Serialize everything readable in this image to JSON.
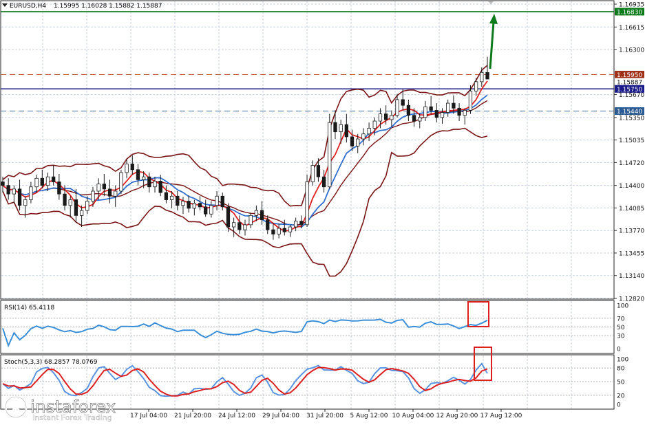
{
  "header": {
    "symbol_tf": "EURUSD,H4",
    "ohlc": "1.15995 1.16028 1.15882 1.15887"
  },
  "colors": {
    "bg": "#ffffff",
    "grid": "#c8d2de",
    "candle_bull": "#1a1a1a",
    "candle_bear": "#1a1a1a",
    "bollinger": "#7a1414",
    "ma_fast": "#e02020",
    "ma_slow": "#2f6fd0",
    "rsi_line": "#3a8fd8",
    "stoch_main": "#5b94e0",
    "stoch_signal": "#dd1f1f",
    "resistance": "#0b7a1b",
    "support": "#1a1a88",
    "level_dashed_upper": "#c0502a",
    "level_dashed_lower": "#3f6fa5",
    "highlight_box": "#dd1f1f",
    "arrow": "#0b7a1b"
  },
  "price_axis": {
    "ticks": [
      "1.16935",
      "1.16615",
      "1.16300",
      "1.15670",
      "1.15350",
      "1.15035",
      "1.14720",
      "1.14400",
      "1.14085",
      "1.13770",
      "1.13455",
      "1.13140",
      "1.12820"
    ],
    "tick_values": [
      1.16935,
      1.16615,
      1.163,
      1.1567,
      1.1535,
      1.15035,
      1.1472,
      1.144,
      1.14085,
      1.1377,
      1.13455,
      1.1314,
      1.1282
    ]
  },
  "levels": {
    "resistance": {
      "label": "1.16830",
      "value": 1.1683
    },
    "dashed_upper": {
      "label": "1.15950",
      "value": 1.1595
    },
    "current": {
      "label": "1.15887",
      "value": 1.15887
    },
    "support": {
      "label": "1.15750",
      "value": 1.1575
    },
    "dashed_lower": {
      "label": "1.15440",
      "value": 1.1544
    }
  },
  "rsi": {
    "label": "RSI(14) 65.4118",
    "ticks": [
      "100",
      "70",
      "50",
      "30",
      "0"
    ],
    "tick_values": [
      100,
      70,
      50,
      30,
      0
    ]
  },
  "stoch": {
    "label": "Stoch(5,3,3) 68.2857 78.0769",
    "ticks": [
      "100",
      "80",
      "50",
      "20",
      "0"
    ],
    "tick_values": [
      100,
      80,
      50,
      20,
      0
    ]
  },
  "time_axis": {
    "labels": [
      "17 Jul 04:00",
      "21 Jul 20:00",
      "24 Jul 12:00",
      "29 Jul 04:00",
      "31 Jul 20:00",
      "5 Aug 12:00",
      "10 Aug 04:00",
      "12 Aug 20:00",
      "17 Aug 12:00"
    ]
  },
  "watermark": {
    "brand": "instaforex",
    "tagline": "Instant Forex Trading"
  },
  "chart_data": {
    "type": "candlestick",
    "symbol": "EURUSD",
    "timeframe": "H4",
    "ylim": [
      1.1282,
      1.16935
    ],
    "indicators": [
      "Bollinger Bands",
      "Moving Average (fast)",
      "Moving Average (slow)",
      "RSI(14)",
      "Stoch(5,3,3)"
    ],
    "ohlc": [
      [
        1.1445,
        1.1452,
        1.143,
        1.144
      ],
      [
        1.144,
        1.145,
        1.142,
        1.1428
      ],
      [
        1.1428,
        1.144,
        1.1415,
        1.1435
      ],
      [
        1.1435,
        1.1448,
        1.1405,
        1.1412
      ],
      [
        1.1412,
        1.1425,
        1.1395,
        1.142
      ],
      [
        1.142,
        1.1445,
        1.1415,
        1.1438
      ],
      [
        1.1438,
        1.1455,
        1.143,
        1.145
      ],
      [
        1.145,
        1.1462,
        1.1436,
        1.144
      ],
      [
        1.144,
        1.1458,
        1.1432,
        1.1452
      ],
      [
        1.1452,
        1.1468,
        1.144,
        1.1445
      ],
      [
        1.1445,
        1.1456,
        1.142,
        1.1428
      ],
      [
        1.1428,
        1.144,
        1.1405,
        1.1412
      ],
      [
        1.1412,
        1.1425,
        1.1395,
        1.142
      ],
      [
        1.142,
        1.1435,
        1.1388,
        1.1398
      ],
      [
        1.1398,
        1.1412,
        1.1382,
        1.1405
      ],
      [
        1.1405,
        1.1425,
        1.14,
        1.1418
      ],
      [
        1.1418,
        1.1438,
        1.141,
        1.1432
      ],
      [
        1.1432,
        1.145,
        1.142,
        1.1442
      ],
      [
        1.1442,
        1.1456,
        1.1425,
        1.1435
      ],
      [
        1.1435,
        1.1448,
        1.1415,
        1.1425
      ],
      [
        1.1425,
        1.144,
        1.141,
        1.1432
      ],
      [
        1.1432,
        1.1462,
        1.1428,
        1.1458
      ],
      [
        1.1458,
        1.1476,
        1.145,
        1.147
      ],
      [
        1.147,
        1.1482,
        1.1455,
        1.1462
      ],
      [
        1.1462,
        1.147,
        1.144,
        1.1448
      ],
      [
        1.1448,
        1.146,
        1.1436,
        1.1452
      ],
      [
        1.1452,
        1.1458,
        1.143,
        1.1438
      ],
      [
        1.1438,
        1.1452,
        1.143,
        1.1446
      ],
      [
        1.1446,
        1.1455,
        1.1425,
        1.143
      ],
      [
        1.143,
        1.144,
        1.1415,
        1.142
      ],
      [
        1.142,
        1.1432,
        1.1408,
        1.1425
      ],
      [
        1.1425,
        1.1432,
        1.1405,
        1.1412
      ],
      [
        1.1412,
        1.1424,
        1.14,
        1.1418
      ],
      [
        1.1418,
        1.1426,
        1.1402,
        1.1408
      ],
      [
        1.1408,
        1.142,
        1.1398,
        1.1415
      ],
      [
        1.1415,
        1.1425,
        1.1405,
        1.141
      ],
      [
        1.141,
        1.142,
        1.1396,
        1.14
      ],
      [
        1.14,
        1.1418,
        1.1395,
        1.1412
      ],
      [
        1.1412,
        1.1432,
        1.1405,
        1.1425
      ],
      [
        1.1425,
        1.143,
        1.1405,
        1.141
      ],
      [
        1.141,
        1.1415,
        1.1375,
        1.1382
      ],
      [
        1.1382,
        1.1395,
        1.1368,
        1.1388
      ],
      [
        1.1388,
        1.1398,
        1.1372,
        1.1378
      ],
      [
        1.1378,
        1.1392,
        1.137,
        1.1385
      ],
      [
        1.1385,
        1.1402,
        1.138,
        1.1398
      ],
      [
        1.1398,
        1.1412,
        1.139,
        1.1405
      ],
      [
        1.1405,
        1.1418,
        1.1385,
        1.1392
      ],
      [
        1.1392,
        1.1398,
        1.1372,
        1.1378
      ],
      [
        1.1378,
        1.1388,
        1.1364,
        1.1372
      ],
      [
        1.1372,
        1.1386,
        1.1366,
        1.138
      ],
      [
        1.138,
        1.1392,
        1.137,
        1.1375
      ],
      [
        1.1375,
        1.1385,
        1.1368,
        1.1382
      ],
      [
        1.1382,
        1.1395,
        1.1376,
        1.139
      ],
      [
        1.139,
        1.1398,
        1.138,
        1.1385
      ],
      [
        1.1385,
        1.1455,
        1.1382,
        1.1445
      ],
      [
        1.1445,
        1.1475,
        1.144,
        1.1468
      ],
      [
        1.1468,
        1.1478,
        1.1445,
        1.1452
      ],
      [
        1.1452,
        1.1462,
        1.143,
        1.1438
      ],
      [
        1.1438,
        1.154,
        1.1435,
        1.1528
      ],
      [
        1.1528,
        1.1545,
        1.1505,
        1.1515
      ],
      [
        1.1515,
        1.1532,
        1.1498,
        1.1525
      ],
      [
        1.1525,
        1.154,
        1.15,
        1.1508
      ],
      [
        1.1508,
        1.1518,
        1.1488,
        1.1495
      ],
      [
        1.1495,
        1.1512,
        1.1485,
        1.1505
      ],
      [
        1.1505,
        1.152,
        1.1496,
        1.1512
      ],
      [
        1.1512,
        1.1528,
        1.1502,
        1.152
      ],
      [
        1.152,
        1.1535,
        1.151,
        1.153
      ],
      [
        1.153,
        1.1548,
        1.152,
        1.154
      ],
      [
        1.154,
        1.1552,
        1.1525,
        1.1532
      ],
      [
        1.1532,
        1.1545,
        1.1522,
        1.1538
      ],
      [
        1.1538,
        1.1568,
        1.1535,
        1.156
      ],
      [
        1.156,
        1.1575,
        1.1545,
        1.1552
      ],
      [
        1.1552,
        1.156,
        1.153,
        1.1538
      ],
      [
        1.1538,
        1.1548,
        1.1522,
        1.153
      ],
      [
        1.153,
        1.154,
        1.152,
        1.1535
      ],
      [
        1.1535,
        1.1558,
        1.153,
        1.155
      ],
      [
        1.155,
        1.1565,
        1.154,
        1.1545
      ],
      [
        1.1545,
        1.1555,
        1.1528,
        1.1535
      ],
      [
        1.1535,
        1.1548,
        1.1526,
        1.1542
      ],
      [
        1.1542,
        1.156,
        1.1536,
        1.1555
      ],
      [
        1.1555,
        1.1566,
        1.154,
        1.1548
      ],
      [
        1.1548,
        1.1555,
        1.153,
        1.1538
      ],
      [
        1.1538,
        1.1548,
        1.1525,
        1.1545
      ],
      [
        1.1545,
        1.158,
        1.154,
        1.1572
      ],
      [
        1.1572,
        1.159,
        1.1565,
        1.1585
      ],
      [
        1.1585,
        1.1605,
        1.1578,
        1.1598
      ],
      [
        1.1598,
        1.162,
        1.159,
        1.15887
      ]
    ]
  }
}
